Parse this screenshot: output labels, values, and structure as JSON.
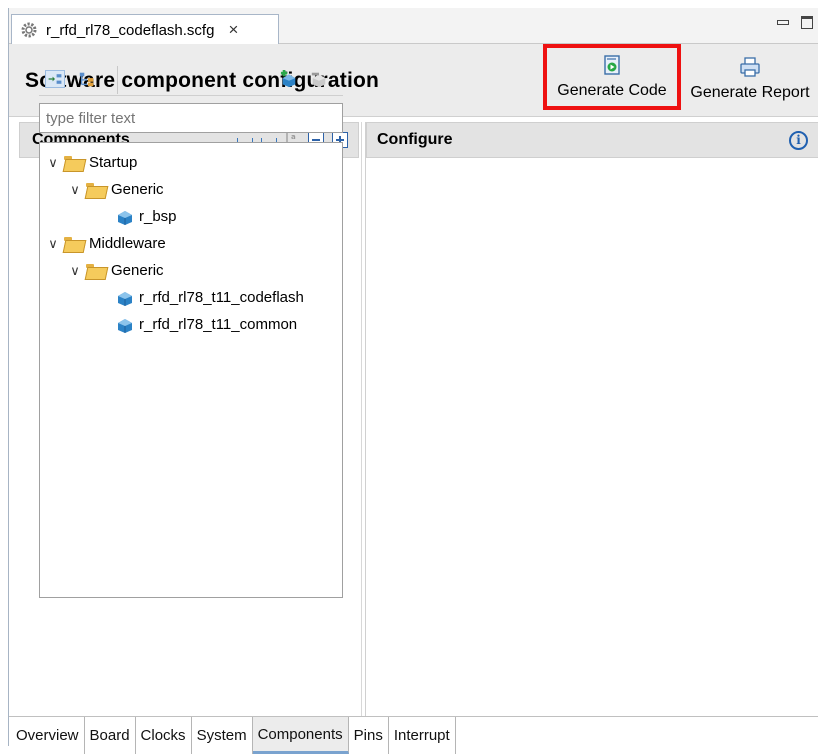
{
  "editor_tab": {
    "title": "r_rfd_rl78_codeflash.scfg",
    "close": "×",
    "icon": "gear-icon"
  },
  "header": {
    "title": "Software component configuration",
    "generate_code": "Generate Code",
    "generate_report": "Generate Report",
    "highlight_color": "#ee1111"
  },
  "components_panel": {
    "title": "Components",
    "filter_placeholder": "type filter text",
    "tree": [
      {
        "label": "Startup",
        "type": "folder",
        "level": 0
      },
      {
        "label": "Generic",
        "type": "folder",
        "level": 1
      },
      {
        "label": "r_bsp",
        "type": "component",
        "level": 2
      },
      {
        "label": "Middleware",
        "type": "folder",
        "level": 0
      },
      {
        "label": "Generic",
        "type": "folder",
        "level": 1
      },
      {
        "label": "r_rfd_rl78_t11_codeflash",
        "type": "component",
        "level": 2
      },
      {
        "label": "r_rfd_rl78_t11_common",
        "type": "component",
        "level": 2
      }
    ]
  },
  "configure_panel": {
    "title": "Configure",
    "info_icon": "i"
  },
  "bottom_tabs": [
    "Overview",
    "Board",
    "Clocks",
    "System",
    "Components",
    "Pins",
    "Interrupt"
  ],
  "active_bottom_tab": "Components"
}
